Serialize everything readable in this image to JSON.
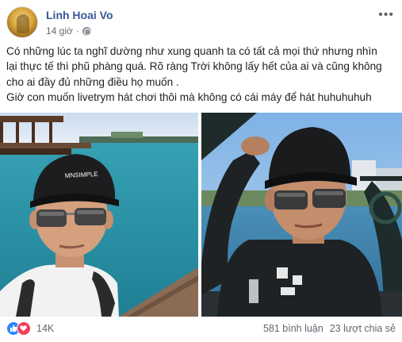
{
  "post": {
    "author": "Linh Hoai Vo",
    "time": "14 giờ",
    "privacy_icon": "globe-icon",
    "more_icon": "ellipsis-icon",
    "text_lines": [
      "Có những lúc ta nghĩ dường như xung quanh ta có tất cả mọi thứ nhưng nhìn",
      "lại thực tế thì phũ phàng quá. Rõ ràng Trời không lấy hết của ai và cũng không",
      "cho ai đầy đủ những điều họ muốn .",
      "Giờ con muốn livetrym hát chơi thôi mà không có cái máy để hát huhuhuhuh"
    ],
    "photos": {
      "left_cap_text": "MNSIMPLE"
    }
  },
  "footer": {
    "reaction_icons": [
      "like-icon",
      "heart-icon"
    ],
    "reaction_count": "14K",
    "comments": "581 bình luận",
    "shares": "23 lượt chia sẻ"
  },
  "colors": {
    "author": "#385898",
    "meta": "#616770",
    "like": "#2d88ff",
    "heart": "#f33e58"
  }
}
